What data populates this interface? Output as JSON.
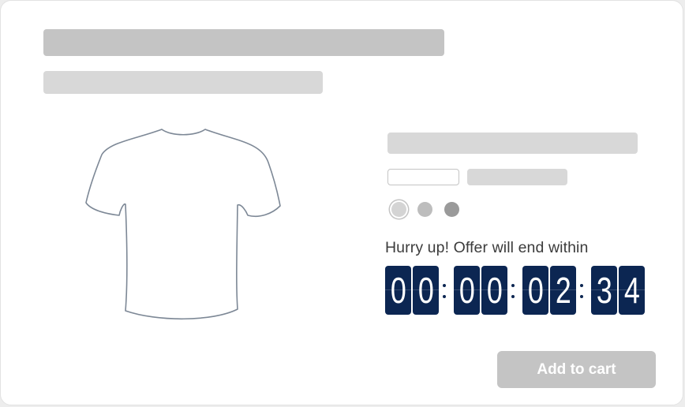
{
  "product": {
    "swatches": [
      {
        "name": "light-gray",
        "color": "#d4d4d4",
        "selected": true
      },
      {
        "name": "medium-gray",
        "color": "#bdbdbd",
        "selected": false
      },
      {
        "name": "dark-gray",
        "color": "#9a9a9a",
        "selected": false
      }
    ]
  },
  "offer": {
    "text": "Hurry up! Offer will end within",
    "countdown": {
      "days": [
        "0",
        "0"
      ],
      "hours": [
        "0",
        "0"
      ],
      "minutes": [
        "0",
        "2"
      ],
      "seconds": [
        "3",
        "4"
      ]
    },
    "digit_color": "#0c2652"
  },
  "cart": {
    "button_label": "Add to cart",
    "button_color": "#c4c4c4"
  }
}
